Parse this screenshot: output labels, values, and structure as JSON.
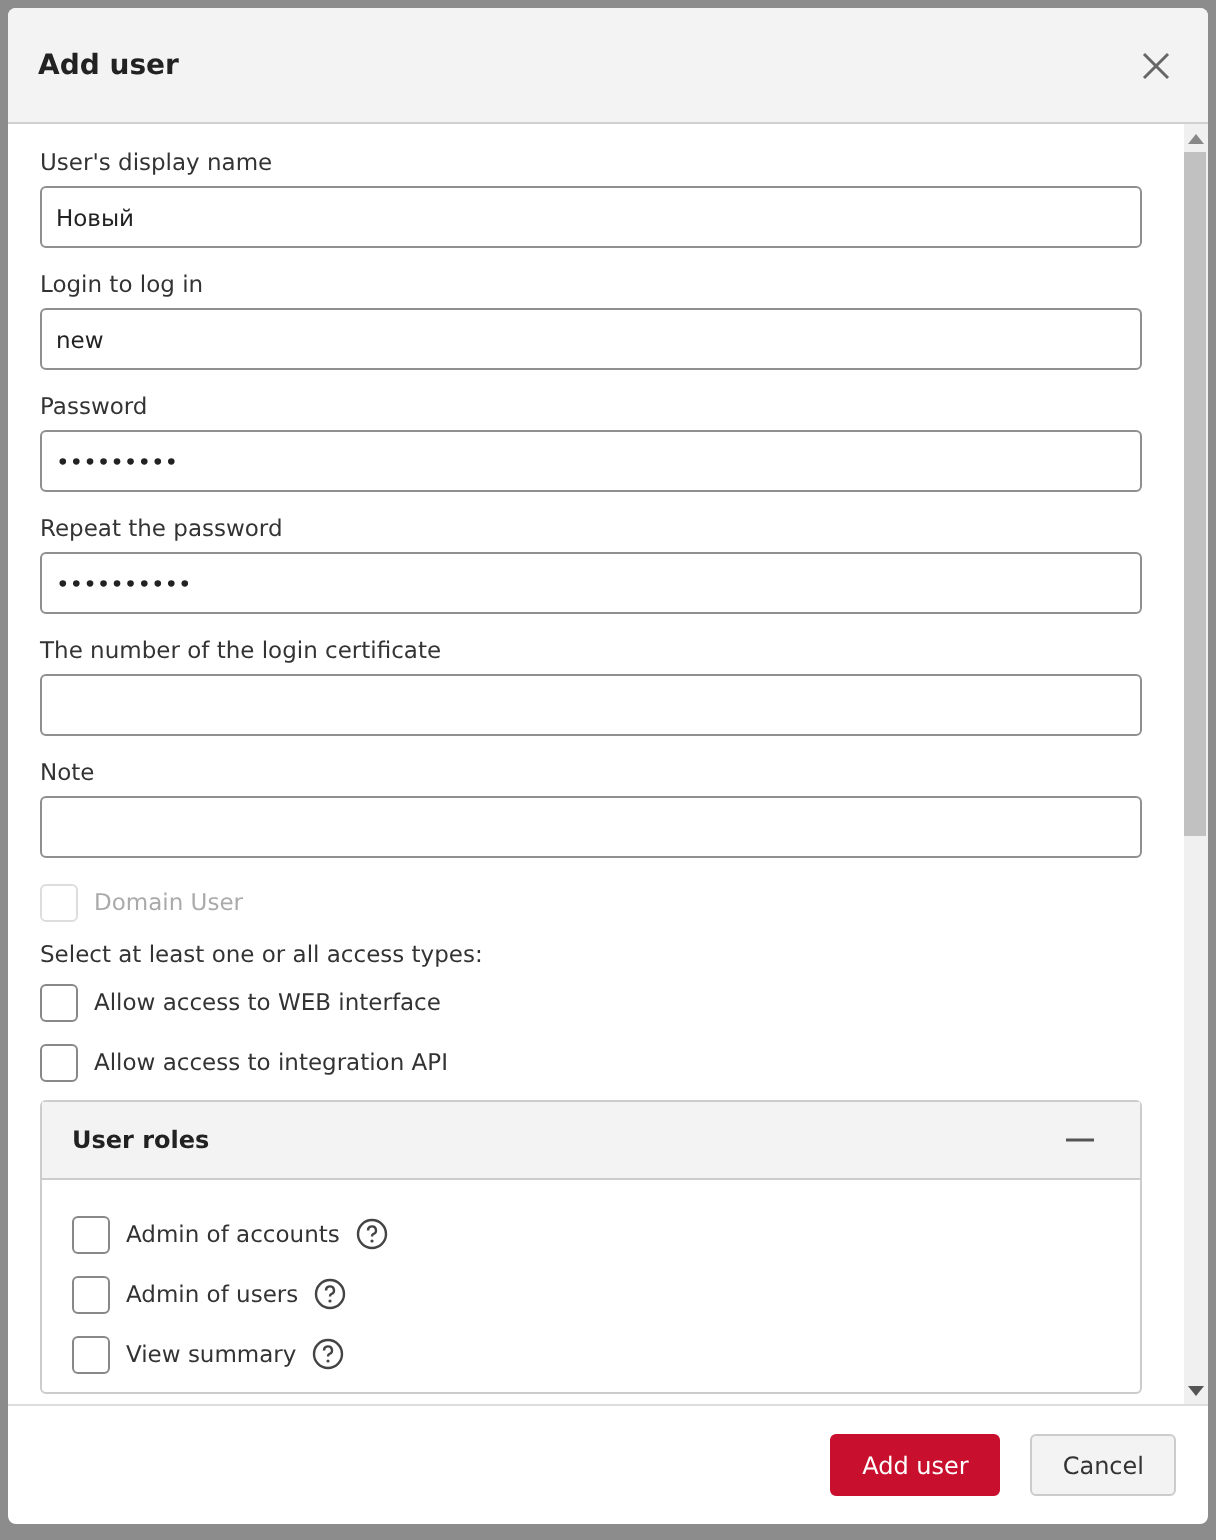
{
  "dialog": {
    "title": "Add user"
  },
  "fields": [
    {
      "label": "User's display name",
      "value": "Новый"
    },
    {
      "label": "Login to log in",
      "value": "new"
    },
    {
      "label": "Password",
      "value": "•••••••••"
    },
    {
      "label": "Repeat the password",
      "value": "••••••••••"
    },
    {
      "label": "The number of the login certificate"
    },
    {
      "label": "Note"
    }
  ],
  "domain_user": {
    "label": "Domain User",
    "checked": false,
    "disabled": true
  },
  "access_hint": "Select at least one or all access types:",
  "access_types": [
    {
      "label": "Allow access to WEB interface",
      "checked": false
    },
    {
      "label": "Allow access to integration API",
      "checked": false
    }
  ],
  "user_roles": {
    "title": "User roles",
    "expanded": true,
    "roles": [
      {
        "label": "Admin of accounts",
        "checked": false
      },
      {
        "label": "Admin of users",
        "checked": false
      },
      {
        "label": "View summary",
        "checked": false
      }
    ]
  },
  "buttons": [
    {
      "label": "Add user",
      "kind": "primary"
    },
    {
      "label": "Cancel",
      "kind": "secondary"
    }
  ]
}
